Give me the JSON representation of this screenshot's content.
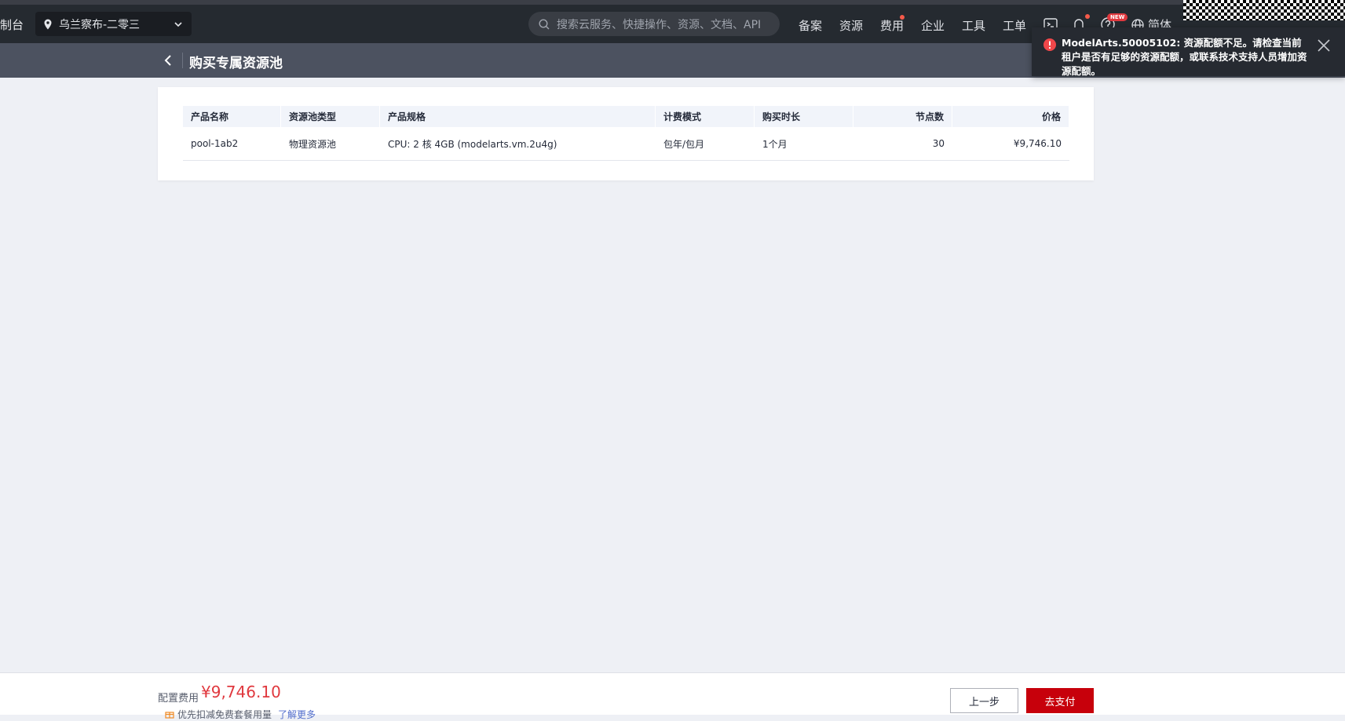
{
  "topbar": {
    "console_fragment": "制台",
    "region": "乌兰察布-二零三",
    "search_placeholder": "搜索云服务、快捷操作、资源、文档、API",
    "nav": [
      "备案",
      "资源",
      "费用",
      "企业",
      "工具",
      "工单"
    ],
    "new_badge": "NEW",
    "language": "简体",
    "icons": [
      "cloud-shell-icon",
      "bell-icon",
      "help-icon",
      "globe-icon"
    ]
  },
  "subheader": {
    "title": "购买专属资源池"
  },
  "toast": {
    "message": "ModelArts.50005102: 资源配额不足。请检查当前租户是否有足够的资源配额，或联系技术支持人员增加资源配额。"
  },
  "table": {
    "headers": [
      "产品名称",
      "资源池类型",
      "产品规格",
      "计费模式",
      "购买时长",
      "节点数",
      "价格"
    ],
    "rows": [
      [
        "pool-1ab2",
        "物理资源池",
        "CPU: 2 核 4GB (modelarts.vm.2u4g)",
        "包年/包月",
        "1个月",
        "30",
        "¥9,746.10"
      ]
    ]
  },
  "footer": {
    "fee_label": "配置费用",
    "fee_value": "¥9,746.10",
    "promo_text": "优先扣减免费套餐用量",
    "learn_more": "了解更多",
    "prev_button": "上一步",
    "pay_button": "去支付"
  },
  "colors": {
    "accent_red": "#c7000b",
    "price_red": "#e0383e",
    "topbar": "#252a30",
    "subheader": "#4c5260",
    "link": "#526ecc"
  }
}
